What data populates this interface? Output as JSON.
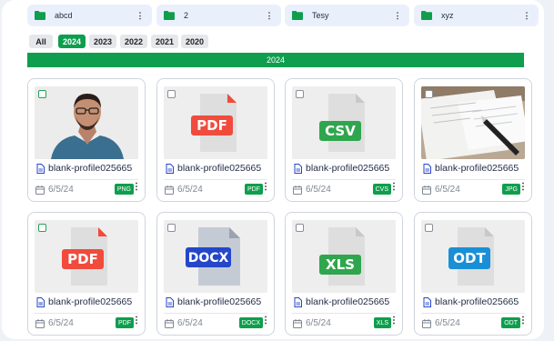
{
  "folders": [
    {
      "name": "abcd"
    },
    {
      "name": "2"
    },
    {
      "name": "Tesy"
    },
    {
      "name": "xyz"
    }
  ],
  "year_tabs": [
    "All",
    "2024",
    "2023",
    "2022",
    "2021",
    "2020"
  ],
  "active_year": "2024",
  "year_banner": "2024",
  "cards": [
    {
      "filename": "blank-profile025665",
      "date": "6/5/24",
      "type": "PNG",
      "thumb": "photo-man"
    },
    {
      "filename": "blank-profile025665",
      "date": "6/5/24",
      "type": "PDF",
      "thumb": "pdf-file-icon"
    },
    {
      "filename": "blank-profile025665",
      "date": "6/5/24",
      "type": "CVS",
      "thumb": "csv-file-icon",
      "thumb_label": "CSV"
    },
    {
      "filename": "blank-profile025665",
      "date": "6/5/24",
      "type": "JPG",
      "thumb": "photo-documents"
    },
    {
      "filename": "blank-profile025665",
      "date": "6/5/24",
      "type": "PDF",
      "thumb": "pdf-file-icon"
    },
    {
      "filename": "blank-profile025665",
      "date": "6/5/24",
      "type": "DOCX",
      "thumb": "docx-file-icon"
    },
    {
      "filename": "blank-profile025665",
      "date": "6/5/24",
      "type": "XLS",
      "thumb": "xls-file-icon"
    },
    {
      "filename": "blank-profile025665",
      "date": "6/5/24",
      "type": "ODT",
      "thumb": "odt-file-icon"
    }
  ],
  "colors": {
    "accent": "#0e9e4d",
    "pdf": "#f04b3d",
    "csv": "#2fa64e",
    "docx": "#2446c9",
    "xls": "#2fa64e",
    "odt": "#1a8fd6"
  }
}
